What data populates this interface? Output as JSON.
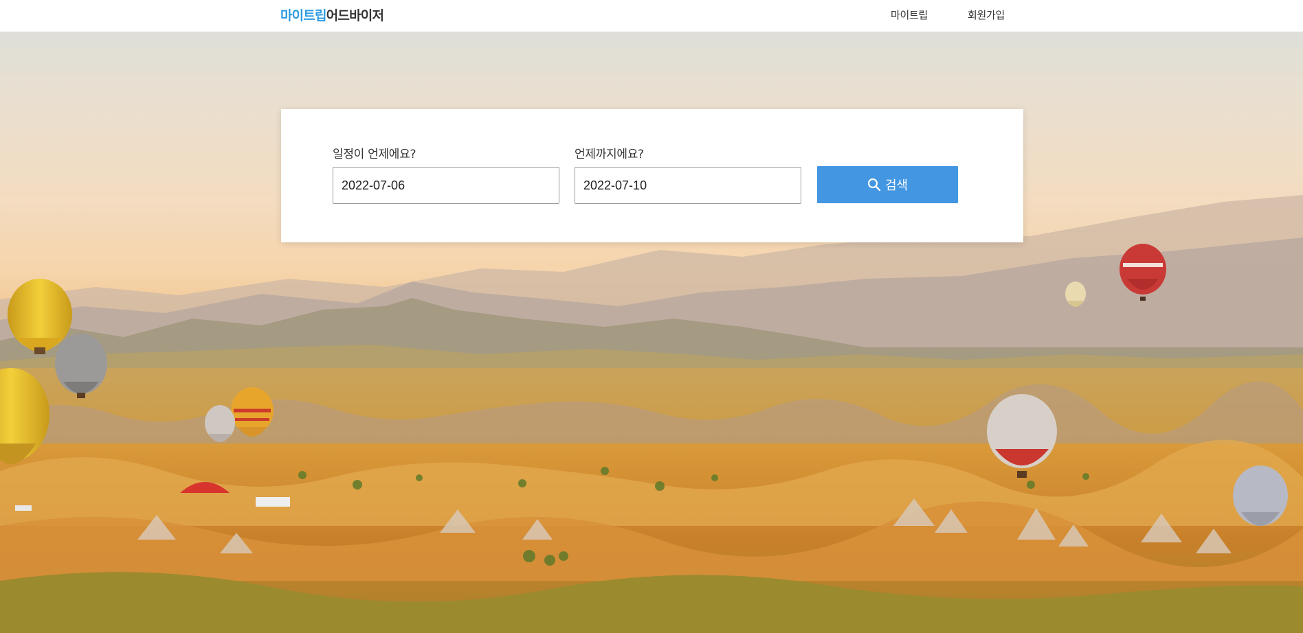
{
  "header": {
    "brand": "마이트립",
    "brand_rest": "어드바이저",
    "nav": {
      "mytrip": "마이트립",
      "signup": "회원가입"
    }
  },
  "search": {
    "start_label": "일정이 언제에요?",
    "start_value": "2022-07-06",
    "end_label": "언제까지에요?",
    "end_value": "2022-07-10",
    "button_label": "검색",
    "button_icon": "search-icon"
  },
  "colors": {
    "brand": "#2a9be0",
    "button": "#4396e1"
  }
}
